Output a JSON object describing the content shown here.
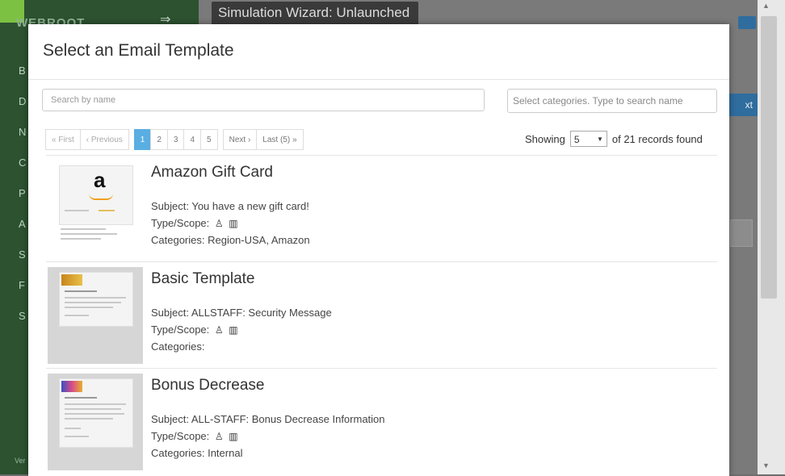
{
  "background": {
    "logo": "WEBROOT",
    "arrow_icon": "arrow-right-icon",
    "nav_letters": [
      "B",
      "D",
      "N",
      "C",
      "P",
      "A",
      "S",
      "F",
      "S"
    ],
    "title": "Simulation Wizard: Unlaunched",
    "next_button": "xt",
    "footer": "Ver"
  },
  "modal": {
    "title": "Select an Email Template",
    "search_placeholder": "Search by name",
    "category_placeholder": "Select categories. Type to search name"
  },
  "pagination": {
    "first": "« First",
    "previous": "‹ Previous",
    "pages": [
      "1",
      "2",
      "3",
      "4",
      "5"
    ],
    "active_page": "1",
    "next": "Next ›",
    "last": "Last (5) »"
  },
  "showing": {
    "label": "Showing",
    "per_page": "5",
    "suffix": "of 21 records found"
  },
  "templates": [
    {
      "title": "Amazon Gift Card",
      "subject": "Subject: You have a new gift card!",
      "type_scope": "Type/Scope:",
      "categories": "Categories: Region-USA, Amazon",
      "thumb_text": "a"
    },
    {
      "title": "Basic Template",
      "subject": "Subject: ALLSTAFF: Security Message",
      "type_scope": "Type/Scope:",
      "categories": "Categories:"
    },
    {
      "title": "Bonus Decrease",
      "subject": "Subject: ALL-STAFF: Bonus Decrease Information",
      "type_scope": "Type/Scope:",
      "categories": "Categories: Internal"
    }
  ],
  "icons": {
    "scope_user": "user-lock-icon",
    "scope_building": "building-icon"
  },
  "colors": {
    "sidebar": "#2c5230",
    "accent": "#7dc142",
    "active_page": "#5aaee2",
    "primary_button": "#2f6d9e"
  }
}
